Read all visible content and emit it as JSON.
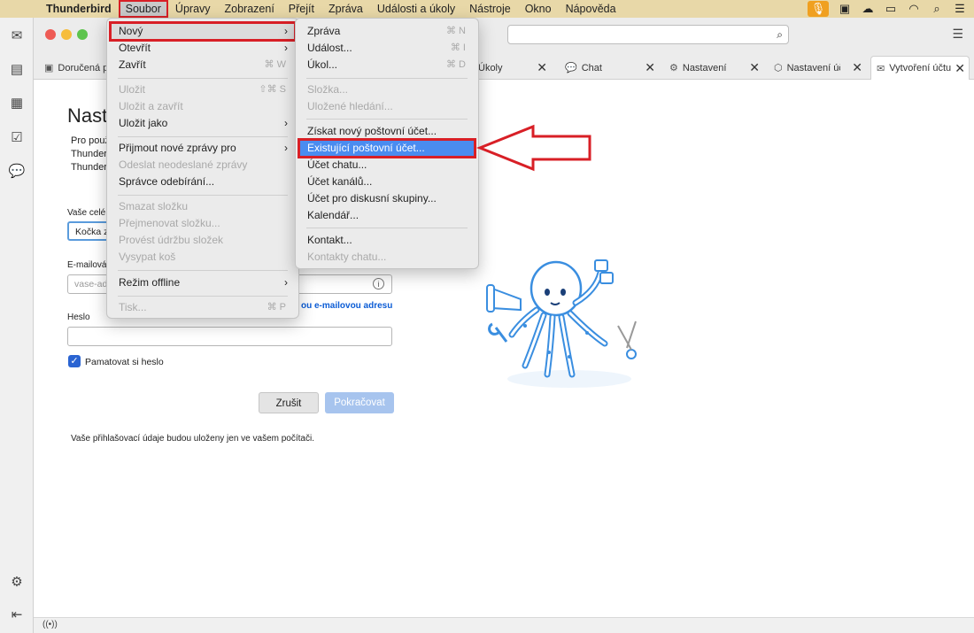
{
  "menubar": {
    "app_name": "Thunderbird",
    "items": [
      "Soubor",
      "Úpravy",
      "Zobrazení",
      "Přejít",
      "Zpráva",
      "Události a úkoly",
      "Nástroje",
      "Okno",
      "Nápověda"
    ]
  },
  "tabs": [
    {
      "label": "Doručená pošta",
      "icon": "inbox-icon"
    },
    {
      "label": "Úkoly",
      "icon": "tasks-icon"
    },
    {
      "label": "Chat",
      "icon": "chat-icon"
    },
    {
      "label": "Nastavení",
      "icon": "gear-icon"
    },
    {
      "label": "Nastavení účtu",
      "icon": "account-settings-icon"
    },
    {
      "label": "Vytvoření účtu",
      "icon": "mail-icon"
    }
  ],
  "page": {
    "title": "Nastavení",
    "intro_lines": [
      "Pro použití",
      "Thunderbird",
      "Thunderbird"
    ],
    "name_label": "Vaše celé jméno",
    "name_value": "Kočka z",
    "email_label": "E-mailová adresa",
    "email_placeholder": "vase-adresa",
    "email_link": "ou e-mailovou adresu",
    "password_label": "Heslo",
    "remember_label": "Pamatovat si heslo",
    "cancel_label": "Zrušit",
    "continue_label": "Pokračovat",
    "note": "Vaše přihlašovací údaje budou uloženy jen ve vašem počítači."
  },
  "file_menu": [
    {
      "label": "Nový",
      "submenu": true,
      "highlighted": true
    },
    {
      "label": "Otevřít",
      "submenu": true
    },
    {
      "label": "Zavřít",
      "shortcut": "⌘ W"
    },
    {
      "separator": true
    },
    {
      "label": "Uložit",
      "shortcut": "⇧⌘ S",
      "disabled": true
    },
    {
      "label": "Uložit a zavřít",
      "disabled": true
    },
    {
      "label": "Uložit jako",
      "submenu": true
    },
    {
      "separator": true
    },
    {
      "label": "Přijmout nové zprávy pro",
      "submenu": true
    },
    {
      "label": "Odeslat neodeslané zprávy",
      "disabled": true
    },
    {
      "label": "Správce odebírání..."
    },
    {
      "separator": true
    },
    {
      "label": "Smazat složku",
      "disabled": true
    },
    {
      "label": "Přejmenovat složku...",
      "disabled": true
    },
    {
      "label": "Provést údržbu složek",
      "disabled": true
    },
    {
      "label": "Vysypat koš",
      "disabled": true
    },
    {
      "separator": true
    },
    {
      "label": "Režim offline",
      "submenu": true
    },
    {
      "separator": true
    },
    {
      "label": "Tisk...",
      "shortcut": "⌘ P",
      "disabled": true
    }
  ],
  "new_submenu": [
    {
      "label": "Zpráva",
      "shortcut": "⌘ N"
    },
    {
      "label": "Událost...",
      "shortcut": "⌘ I"
    },
    {
      "label": "Úkol...",
      "shortcut": "⌘ D"
    },
    {
      "separator": true
    },
    {
      "label": "Složka...",
      "disabled": true
    },
    {
      "label": "Uložené hledání...",
      "disabled": true
    },
    {
      "separator": true
    },
    {
      "label": "Získat nový poštovní účet..."
    },
    {
      "label": "Existující poštovní účet...",
      "selected": true
    },
    {
      "label": "Účet chatu..."
    },
    {
      "label": "Účet kanálů..."
    },
    {
      "label": "Účet pro diskusní skupiny..."
    },
    {
      "label": "Kalendář..."
    },
    {
      "separator": true
    },
    {
      "label": "Kontakt..."
    },
    {
      "label": "Kontakty chatu...",
      "disabled": true
    }
  ],
  "colors": {
    "menubar_bg": "#e8d8a8",
    "highlight_red": "#d81f26",
    "selection_blue": "#4a8cf0",
    "link_blue": "#0b5cd5",
    "octopus_blue": "#3a8ee0"
  }
}
